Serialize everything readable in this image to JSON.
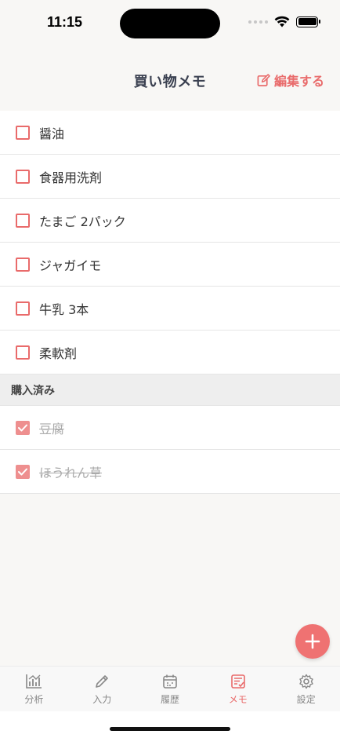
{
  "status": {
    "time": "11:15"
  },
  "nav": {
    "title": "買い物メモ",
    "edit_label": "編集する"
  },
  "items": [
    {
      "label": "醤油",
      "checked": false
    },
    {
      "label": "食器用洗剤",
      "checked": false
    },
    {
      "label": "たまご 2パック",
      "checked": false
    },
    {
      "label": "ジャガイモ",
      "checked": false
    },
    {
      "label": "牛乳 3本",
      "checked": false
    },
    {
      "label": "柔軟剤",
      "checked": false
    }
  ],
  "purchased_section": {
    "title": "購入済み"
  },
  "purchased_items": [
    {
      "label": "豆腐",
      "checked": true
    },
    {
      "label": "ほうれん草",
      "checked": true
    }
  ],
  "tabs": [
    {
      "label": "分析",
      "icon": "chart-icon",
      "active": false
    },
    {
      "label": "入力",
      "icon": "pencil-icon",
      "active": false
    },
    {
      "label": "履歴",
      "icon": "calendar-icon",
      "active": false
    },
    {
      "label": "メモ",
      "icon": "memo-icon",
      "active": true
    },
    {
      "label": "設定",
      "icon": "gear-icon",
      "active": false
    }
  ],
  "colors": {
    "accent": "#e96b6b",
    "fab": "#ef7272"
  }
}
